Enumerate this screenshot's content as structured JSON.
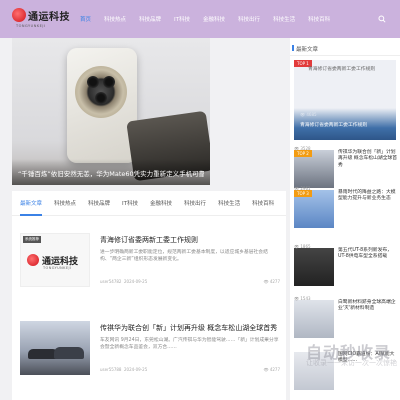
{
  "header": {
    "logo_text": "通运科技",
    "logo_sub": "TONGYUNKEJI",
    "nav": [
      "首页",
      "科技热点",
      "科技品牌",
      "IT科技",
      "金融科技",
      "科技出行",
      "科技生活",
      "科技百科"
    ],
    "active_nav": 0,
    "search_icon": "search-icon",
    "colors": {
      "bar": "#cbb2dd",
      "accent": "#3b82e6"
    }
  },
  "hero": {
    "title": "“千锤百炼”依旧安然无恙，华为Mate60凭实力重新定义手机可靠性"
  },
  "tabs": {
    "items": [
      "最新文章",
      "科技热点",
      "科技品牌",
      "IT科技",
      "金融科技",
      "科技出行",
      "科技生活",
      "科技百科"
    ],
    "active": 0
  },
  "articles": [
    {
      "thumb_tag": "系统推荐",
      "thumb_logo": "通运科技",
      "thumb_logo_sub": "TONGYUNKEJI",
      "title": "青海修订省委两新工委工作规则",
      "desc": "进一步明确两新工委职能定位，规范两新工委基本制度，以适应城乡基层社会结构、“两企三新”组织形态发展新变化。",
      "author": "user54782",
      "date": "2024-09-25",
      "views": "4277"
    },
    {
      "thumb_tag": "",
      "title": "传祺华为联合创「新」计划再升级 概念车松山湖全球首秀",
      "desc": "车友网讯 9月24日，东莞松山湖。广汽传祺与华为智能驾驶……「新」计划成果分享会暨全新概念车品鉴会，双方合……",
      "author": "user55788",
      "date": "2024-09-25",
      "views": "4277"
    }
  ],
  "sidebar": {
    "heading": "最新文章",
    "top1": {
      "badge": "TOP 1",
      "title": "青海修订省委两新工委工作规则",
      "views": "4685"
    },
    "top2": {
      "badge": "TOP 2",
      "views": "3528",
      "title": "传祺华为联合创「新」计划再升级 概念车松山湖全球首秀"
    },
    "top3": {
      "badge": "TOP 3",
      "views": "2961",
      "title": "暴雨时代的降益之路：大模型能力提升与新业务生态"
    },
    "item4": {
      "views": "1865",
      "title": "第五代UT-8系列新发布，UT-8供电车型全系搭载"
    },
    "item5": {
      "views": "1543",
      "title": "白鹭新材料跻身全球高端企业'灭'新材料制造"
    },
    "item6": {
      "title": "国网CIO霸道纷：AI赋能大模型……"
    }
  },
  "watermark": {
    "text": "自动秒收录",
    "sub": "让收录一一来访一次一次惊艳"
  }
}
